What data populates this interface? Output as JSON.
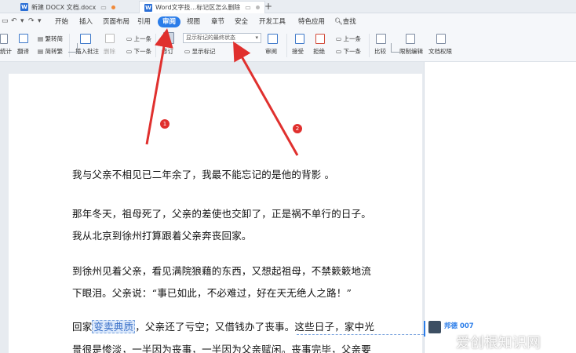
{
  "tabs": [
    {
      "label": "新建 DOCX 文档.docx"
    },
    {
      "label": "Word文字技...标记区怎么删除"
    }
  ],
  "new_tab": "+",
  "menu": {
    "items": [
      "开始",
      "插入",
      "页面布局",
      "引用",
      "审阅",
      "视图",
      "章节",
      "安全",
      "开发工具",
      "特色应用"
    ],
    "active": "审阅",
    "search": "查找"
  },
  "ribbon": {
    "word_count": "统计",
    "translate": "翻译",
    "trad_simplified": "繁转简",
    "simplified_trad": "简转繁",
    "insert_comment": "插入批注",
    "delete": "删除",
    "prev": "上一条",
    "next": "下一条",
    "track_changes": "修订",
    "display_select": "显示标记的最终状态",
    "show_markup": "显示标记",
    "review": "审阅",
    "accept": "接受",
    "reject": "拒绝",
    "prev2": "上一条",
    "next2": "下一条",
    "compare": "比较",
    "restrict_edit": "限制编辑",
    "doc_permission": "文档权限"
  },
  "document": {
    "p1": "我与父亲不相见已二年余了，我最不能忘记的是他的背影 。",
    "p2a": "那年冬天，祖母死了，父亲的差使也交卸了，正是祸不单行的日子。",
    "p2b": "我从北京到徐州打算跟着父亲奔丧回家。",
    "p3a": "到徐州见着父亲，看见满院狼藉的东西，又想起祖母，不禁簌簌地流",
    "p3b": "下眼泪。父亲说：“事已如此，不必难过，好在天无绝人之路！”",
    "p4_pre": "回家",
    "p4_hl": "变卖典质",
    "p4_post": "，父亲还了亏空；又借钱办了丧事。这些日子，家中光",
    "p4b": "景很是惨淡，一半因为丧事，一半因为父亲赋闲。丧事完毕，父亲要"
  },
  "comment": {
    "user": "邦德 007"
  },
  "annotations": {
    "badge1": "1",
    "badge2": "2"
  },
  "watermark": "爱创根知识网",
  "colors": {
    "accent": "#2b7de9",
    "arrow": "#e0302e"
  }
}
